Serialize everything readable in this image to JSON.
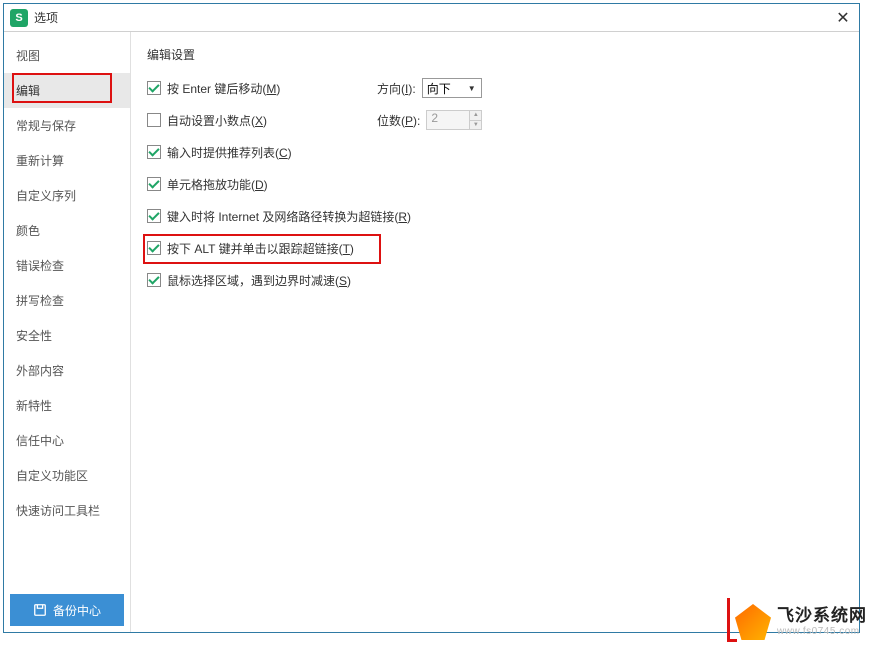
{
  "titlebar": {
    "title": "选项",
    "app_icon_letter": "S"
  },
  "sidebar": {
    "items": [
      {
        "label": "视图"
      },
      {
        "label": "编辑"
      },
      {
        "label": "常规与保存"
      },
      {
        "label": "重新计算"
      },
      {
        "label": "自定义序列"
      },
      {
        "label": "颜色"
      },
      {
        "label": "错误检查"
      },
      {
        "label": "拼写检查"
      },
      {
        "label": "安全性"
      },
      {
        "label": "外部内容"
      },
      {
        "label": "新特性"
      },
      {
        "label": "信任中心"
      },
      {
        "label": "自定义功能区"
      },
      {
        "label": "快速访问工具栏"
      }
    ],
    "backup_label": "备份中心"
  },
  "content": {
    "section_title": "编辑设置",
    "options": [
      {
        "label": "按 Enter 键后移动(",
        "mnemonic": "M",
        "suffix": ")",
        "checked": true
      },
      {
        "label": "自动设置小数点(",
        "mnemonic": "X",
        "suffix": ")",
        "checked": false
      },
      {
        "label": "输入时提供推荐列表(",
        "mnemonic": "C",
        "suffix": ")",
        "checked": true
      },
      {
        "label": "单元格拖放功能(",
        "mnemonic": "D",
        "suffix": ")",
        "checked": true
      },
      {
        "label": "键入时将 Internet 及网络路径转换为超链接(",
        "mnemonic": "R",
        "suffix": ")",
        "checked": true
      },
      {
        "label": "按下 ALT 键并单击以跟踪超链接(",
        "mnemonic": "T",
        "suffix": ")",
        "checked": true
      },
      {
        "label": "鼠标选择区域，遇到边界时减速(",
        "mnemonic": "S",
        "suffix": ")",
        "checked": true
      }
    ],
    "direction": {
      "label": "方向(",
      "mnemonic": "I",
      "suffix": "):",
      "value": "向下"
    },
    "places": {
      "label": "位数(",
      "mnemonic": "P",
      "suffix": "):",
      "value": "2"
    }
  },
  "watermark": {
    "title": "飞沙系统网",
    "sub": "www.fs0745.com"
  }
}
